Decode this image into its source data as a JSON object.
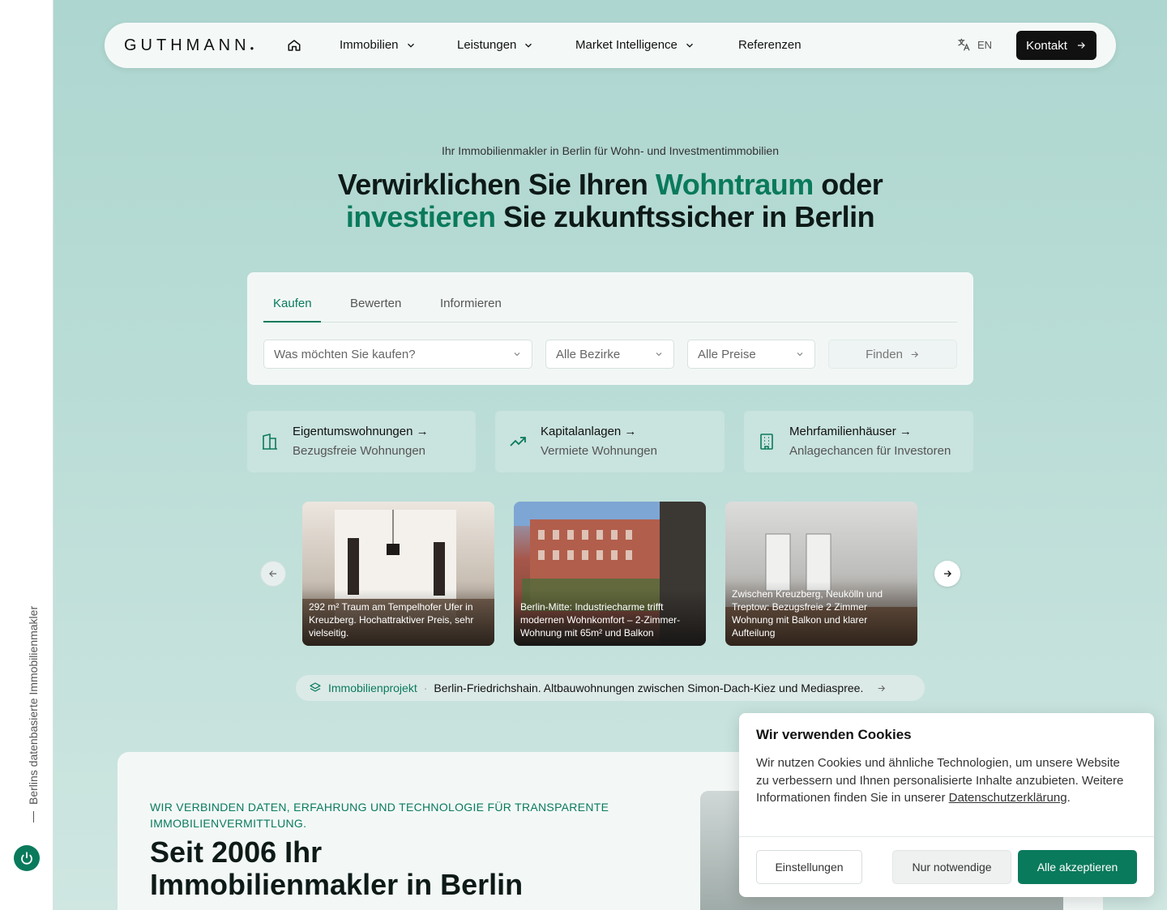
{
  "rail": {
    "tagline": "Berlins datenbasierte Immobilienmakler"
  },
  "nav": {
    "logo": "GUTHMANN",
    "items": [
      {
        "label": "Immobilien"
      },
      {
        "label": "Leistungen"
      },
      {
        "label": "Market Intelligence"
      },
      {
        "label": "Referenzen"
      }
    ],
    "lang": "EN",
    "contact": "Kontakt"
  },
  "hero": {
    "eyebrow": "Ihr Immobilienmakler in Berlin für Wohn- und Investmentimmobilien",
    "line1_a": "Verwirklichen Sie Ihren ",
    "line1_accent": "Wohntraum",
    "line1_b": " oder",
    "line2_accent": "investieren",
    "line2_b": " Sie zukunftssicher in Berlin"
  },
  "search": {
    "tabs": [
      "Kaufen",
      "Bewerten",
      "Informieren"
    ],
    "active_tab": "Kaufen",
    "what_placeholder": "Was möchten Sie kaufen?",
    "district": "Alle Bezirke",
    "price": "Alle Preise",
    "submit": "Finden"
  },
  "categories": [
    {
      "title": "Eigentumswohnungen →",
      "subtitle": "Bezugsfreie Wohnungen",
      "icon": "building-icon"
    },
    {
      "title": "Kapitalanlagen →",
      "subtitle": "Vermiete Wohnungen",
      "icon": "trend-up-icon"
    },
    {
      "title": "Mehrfamilienhäuser →",
      "subtitle": "Anlagechancen für Investoren",
      "icon": "apartment-icon"
    }
  ],
  "listings": [
    {
      "text": "292 m² Traum am Tempelhofer Ufer in Kreuzberg. Hochattraktiver Preis, sehr vielseitig."
    },
    {
      "text": "Berlin-Mitte: Industriecharme trifft modernen Wohnkomfort – 2-Zimmer-Wohnung mit 65m² und Balkon"
    },
    {
      "text": "Zwischen Kreuzberg, Neukölln und Treptow: Bezugsfreie 2 Zimmer Wohnung mit Balkon und klarer Aufteilung"
    }
  ],
  "project": {
    "label": "Immobilienprojekt",
    "separator": "·",
    "text": "Berlin-Friedrichshain. Altbauwohnungen zwischen Simon-Dach-Kiez und Mediaspree."
  },
  "about": {
    "eyebrow": "WIR VERBINDEN DATEN, ERFAHRUNG UND TECHNOLOGIE FÜR TRANSPARENTE IMMOBILIENVERMITTLUNG.",
    "title_line1": "Seit 2006 Ihr",
    "title_line2": "Immobilienmakler in Berlin"
  },
  "cookie": {
    "title": "Wir verwenden Cookies",
    "text": "Wir nutzen Cookies und ähnliche Technologien, um unsere Website zu verbessern und Ihnen personalisierte Inhalte anzubieten. Weitere Informationen finden Sie in unserer ",
    "link": "Datenschutzerklärung",
    "text_end": ".",
    "btn_settings": "Einstellungen",
    "btn_necessary": "Nur notwendige",
    "btn_accept": "Alle akzeptieren"
  },
  "colors": {
    "accent": "#0a7a5c",
    "background": "#b3d9d4",
    "dark": "#111111"
  }
}
